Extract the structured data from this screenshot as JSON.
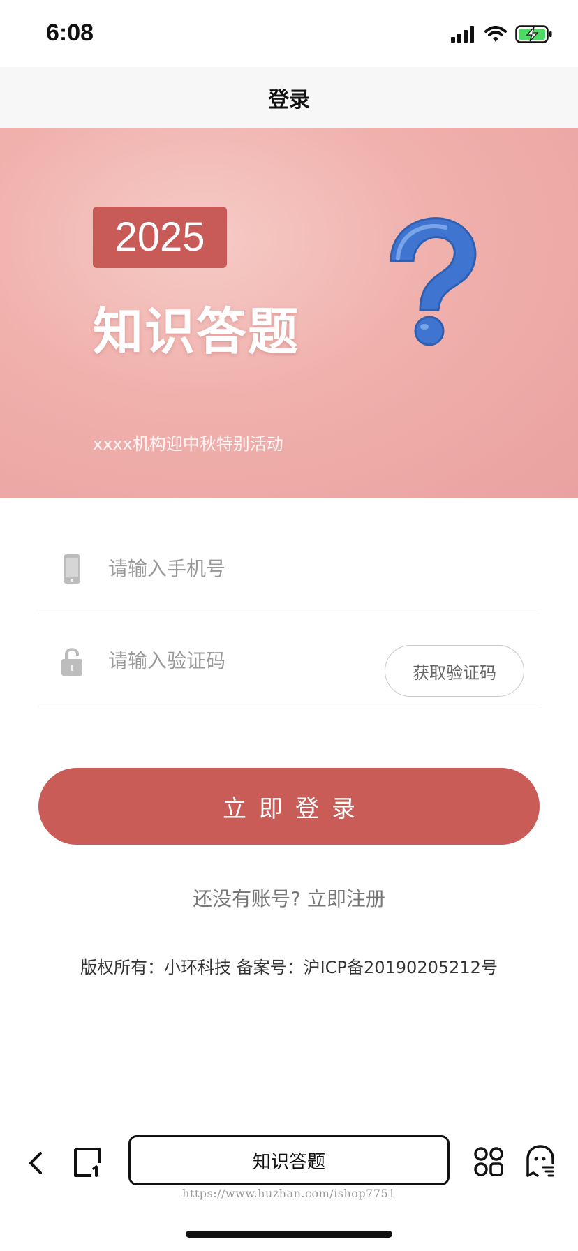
{
  "status_bar": {
    "time": "6:08",
    "icons": [
      "signal-icon",
      "wifi-icon",
      "battery-charging-icon"
    ]
  },
  "nav": {
    "title": "登录"
  },
  "banner": {
    "year": "2025",
    "title": "知识答题",
    "subtitle": "xxxx机构迎中秋特别活动",
    "image_icon": "question-mark-icon"
  },
  "form": {
    "phone": {
      "icon": "phone-icon",
      "placeholder": "请输入手机号",
      "value": ""
    },
    "code": {
      "icon": "lock-icon",
      "placeholder": "请输入验证码",
      "value": "",
      "button_label": "获取验证码"
    },
    "login_button": "立即登录"
  },
  "register_text": "还没有账号? 立即注册",
  "copyright": "版权所有：小环科技 备案号：沪ICP备20190205212号",
  "bottom_bar": {
    "app_name": "知识答题",
    "icons": [
      "back-icon",
      "page-icon",
      "grid-icon",
      "ghost-icon"
    ]
  },
  "watermark": "https://www.huzhan.com/ishop7751",
  "colors": {
    "accent": "#c95c57",
    "banner_bg": "#f0b0ac",
    "battery": "#4cd964"
  }
}
